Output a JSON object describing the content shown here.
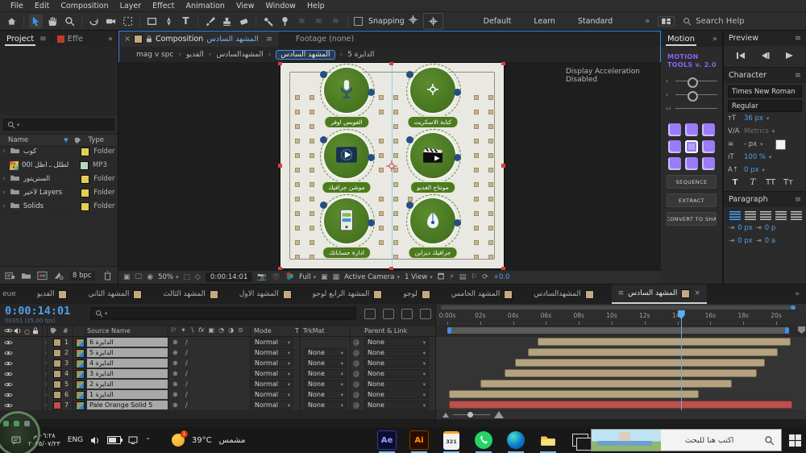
{
  "app": {
    "accent_blue": "#3f96f0",
    "purple": "#8a63f5",
    "green": "#4c7a1e",
    "tan": "#b5a47f",
    "red": "#bf4a47",
    "label_yellow": "#e3cf4f"
  },
  "menu": {
    "items": [
      "File",
      "Edit",
      "Composition",
      "Layer",
      "Effect",
      "Animation",
      "View",
      "Window",
      "Help"
    ]
  },
  "toolbar": {
    "snapping_label": "Snapping",
    "workspaces": [
      "Default",
      "Learn",
      "Standard"
    ],
    "search_help": "Search Help",
    "overflow": "»"
  },
  "project_panel": {
    "tab": "Project",
    "tab_effects": "Effe",
    "overflow": "»",
    "columns": {
      "name": "Name",
      "type": "Type"
    },
    "rows": [
      {
        "name": "كوب",
        "type": "Folder",
        "label_color": "#e3cf4f",
        "icon": "folder-icon",
        "twirl": true
      },
      {
        "name": "الطلل ـ اظل ا00.mp3",
        "type": "MP3",
        "label_color": "#b7d4bd",
        "icon": "audio-icon",
        "twirl": false
      },
      {
        "name": "الستريتور",
        "type": "Folder",
        "label_color": "#e3cf4f",
        "icon": "folder-icon",
        "twirl": true
      },
      {
        "name": "لأخير Layers",
        "type": "Folder",
        "label_color": "#e3cf4f",
        "icon": "folder-icon",
        "twirl": true
      },
      {
        "name": "Solids",
        "type": "Folder",
        "label_color": "#e3cf4f",
        "icon": "folder-icon",
        "twirl": true
      }
    ],
    "bit_depth": "8 bpc"
  },
  "composition_panel": {
    "close": "×",
    "tab_prefix": "Composition",
    "comp_name": "المشهد السادس",
    "menu_icon": "≡",
    "tab_footage": "Footage  (none)",
    "breadcrumb": [
      "mag v spc",
      "الفديو",
      "المشهدالسادس",
      "المشهد السادس",
      "الدايرة 5"
    ],
    "breadcrumb_active_index": 3,
    "viewer_notice": "Display Acceleration Disabled",
    "items": [
      {
        "label": "الفويس اوفر",
        "icon": "microphone-icon"
      },
      {
        "label": "كتابة الاسكريت",
        "icon": "target-icon"
      },
      {
        "label": "موشن جرافيك",
        "icon": "video-player-icon"
      },
      {
        "label": "مونتاج الفديو",
        "icon": "clapperboard-icon"
      },
      {
        "label": "ادارة حساباتك",
        "icon": "phone-icon"
      },
      {
        "label": "جرافيك ديزاين",
        "icon": "pen-nib-icon"
      }
    ],
    "bottom": {
      "zoom": "50%",
      "timecode": "0:00:14:01",
      "resolution": "Full",
      "camera": "Active Camera",
      "view": "1 View",
      "exposure": "+0.0"
    }
  },
  "right_panels": {
    "motion": {
      "tab": "Motion",
      "overflow": "»",
      "title_line1": "MOTION",
      "title_line2": "TOOLS v. 2.0",
      "buttons": [
        "SEQUENCE",
        "EXTRACT",
        "CONVERT TO SHA"
      ]
    },
    "preview": {
      "title": "Preview"
    },
    "character": {
      "title": "Character",
      "font": "Times New Roman",
      "style": "Regular",
      "size": "36 px",
      "kerning": "Metrics",
      "leading": "- px",
      "vertical_scale": "100 %",
      "baseline_shift": "0 px"
    },
    "paragraph": {
      "title": "Paragraph",
      "fields": [
        "0 px",
        "0 p",
        "0 px",
        "0 a"
      ]
    }
  },
  "timeline_tabs": {
    "partial_left": "eue",
    "overflow": "»",
    "tabs": [
      {
        "label": "الفديو"
      },
      {
        "label": "المشهد الثاني"
      },
      {
        "label": "المشهد الثالث"
      },
      {
        "label": "المشهد الاول"
      },
      {
        "label": "المشهد الرابع لوجو"
      },
      {
        "label": "لوجو"
      },
      {
        "label": "المشهد الخامس"
      },
      {
        "label": "المشهدالسادس"
      },
      {
        "label": "المشهد السادس",
        "active": true
      }
    ]
  },
  "timeline": {
    "timecode": "0:00:14:01",
    "frame_info": "00351 (25.00 fps)",
    "columns": {
      "source_name": "Source Name",
      "mode": "Mode",
      "t": "T",
      "trkmat": "TrkMat",
      "parent": "Parent & Link"
    },
    "layers": [
      {
        "num": "1",
        "name": "الدايرة 6",
        "label_color": "#b79f74",
        "mode": "Normal",
        "trkmat": null,
        "parent": "None",
        "bar": {
          "start_s": 5.5,
          "end_s": 20.9,
          "color": "#b4a37e"
        }
      },
      {
        "num": "2",
        "name": "الدايرة 5",
        "label_color": "#b79f74",
        "mode": "Normal",
        "trkmat": "None",
        "parent": "None",
        "bar": {
          "start_s": 4.9,
          "end_s": 20.1,
          "color": "#b4a37e"
        }
      },
      {
        "num": "3",
        "name": "الدايرة 4",
        "label_color": "#b79f74",
        "mode": "Normal",
        "trkmat": "None",
        "parent": "None",
        "bar": {
          "start_s": 4.1,
          "end_s": 19.3,
          "color": "#b4a37e"
        }
      },
      {
        "num": "4",
        "name": "الدايرة 3",
        "label_color": "#b79f74",
        "mode": "Normal",
        "trkmat": "None",
        "parent": "None",
        "bar": {
          "start_s": 3.5,
          "end_s": 18.8,
          "color": "#b4a37e"
        }
      },
      {
        "num": "5",
        "name": "الدايرة 2",
        "label_color": "#b79f74",
        "mode": "Normal",
        "trkmat": "None",
        "parent": "None",
        "bar": {
          "start_s": 2.0,
          "end_s": 17.3,
          "color": "#b4a37e"
        }
      },
      {
        "num": "6",
        "name": "الدايرة 1",
        "label_color": "#b79f74",
        "mode": "Normal",
        "trkmat": "None",
        "parent": "None",
        "bar": {
          "start_s": 0.1,
          "end_s": 15.3,
          "color": "#b4a37e"
        }
      },
      {
        "num": "7",
        "name": "Pale Orange Solid 5",
        "label_color": "#c24e4a",
        "mode": "Normal",
        "trkmat": "None",
        "parent": "None",
        "bar": {
          "start_s": 0.1,
          "end_s": 21.0,
          "color": "#b9514d"
        }
      }
    ],
    "ruler_labels": [
      "0:00s",
      "02s",
      "04s",
      "06s",
      "08s",
      "10s",
      "12s",
      "14s",
      "16s",
      "18s",
      "20s"
    ],
    "playhead_seconds": 14.2
  },
  "taskbar": {
    "search_placeholder": "اكتب هنا للبحث",
    "weather_temp": "39°C",
    "weather_condition": "مشمس",
    "weather_badge": "1",
    "language": "ENG",
    "time": "٠٦:٢٨ م",
    "date": "٢٠٢٥/٠٧/٢٣",
    "apps": [
      {
        "name": "after-effects",
        "label": "Ae"
      },
      {
        "name": "illustrator",
        "label": "Ai"
      },
      {
        "name": "media-player-classic",
        "label": "321"
      },
      {
        "name": "whatsapp"
      },
      {
        "name": "edge"
      },
      {
        "name": "file-explorer"
      }
    ]
  },
  "icons": {
    "search-icon": "magnifier",
    "snapping-icon": "crosshair-magnet",
    "eye-icon": "visibility",
    "speaker-icon": "audio",
    "solo-icon": "circle",
    "lock-icon": "padlock",
    "tag-icon": "label",
    "trash-icon": "trash-can",
    "pickwhip-icon": "@",
    "menu-icon": "≡",
    "chevron-down-icon": "▾",
    "home-icon": "house",
    "selection-tool-icon": "arrow-cursor",
    "hand-tool-icon": "hand",
    "zoom-tool-icon": "magnifier",
    "rotate-tool-icon": "rotate-arrow",
    "camera-tool-icon": "camera",
    "pen-tool-icon": "pen-nib",
    "type-tool-icon": "T",
    "brush-tool-icon": "brush",
    "stamp-tool-icon": "stamp",
    "eraser-tool-icon": "eraser",
    "puppet-pin-icon": "pushpin",
    "windows-logo-icon": "four-pane-window",
    "edge-icon": "swirl-circle",
    "whatsapp-icon": "phone-in-circle",
    "explorer-icon": "yellow-folder",
    "task-view-icon": "stacked-windows",
    "sun-icon": "sun"
  }
}
